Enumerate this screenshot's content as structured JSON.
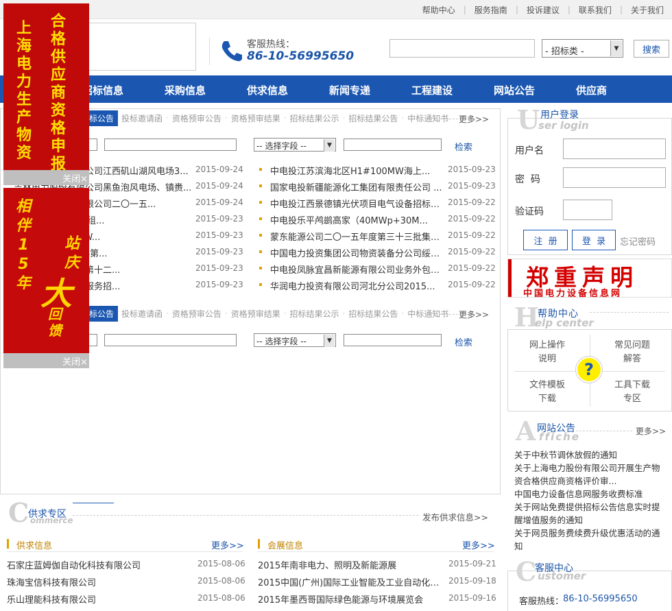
{
  "top_links": [
    "帮助中心",
    "服务指南",
    "投诉建议",
    "联系我们",
    "关于我们"
  ],
  "hotline": {
    "label": "客服热线：",
    "number": "86-10-56995650"
  },
  "search": {
    "select": "- 招标类 -",
    "button": "搜索"
  },
  "nav": [
    "招标信息",
    "采购信息",
    "供求信息",
    "新闻专递",
    "工程建设",
    "网站公告",
    "供应商"
  ],
  "tabs": {
    "active": "招标公告",
    "items": [
      "投标邀请函",
      "资格预审公告",
      "资格预审结果",
      "招标结果公示",
      "招标结果公告",
      "中标通知书"
    ],
    "more": "更多>>"
  },
  "filter": {
    "select": "-- 选择字段 --",
    "button": "检索"
  },
  "list_left": [
    {
      "title": "吉林电力股份有限公司江西矶山湖风电场3...",
      "date": "2015-09-24"
    },
    {
      "title": "吉林电力股份有限公司黑鱼泡风电场、镇赉...",
      "date": "2015-09-24"
    },
    {
      "title": "中电投集团股份有限公司二〇一五...",
      "date": "2015-09-24"
    },
    {
      "title": "电厂2×350MW机组...",
      "date": "2015-09-23"
    },
    {
      "title": "厂二期2×1000MW...",
      "date": "2015-09-23"
    },
    {
      "title": "展有限公司2015年第...",
      "date": "2015-09-23"
    },
    {
      "title": "公司二〇一五年度第十二...",
      "date": "2015-09-23"
    },
    {
      "title": "有限公司物业管理服务招...",
      "date": "2015-09-23"
    }
  ],
  "list_right": [
    {
      "title": "中电投江苏滨海北区H1#100MW海上...",
      "date": "2015-09-23"
    },
    {
      "title": "国家电投新疆能源化工集团有限责任公司 ...",
      "date": "2015-09-23"
    },
    {
      "title": "中电投江西景德镇光伏项目电气设备招标公...",
      "date": "2015-09-22"
    },
    {
      "title": "中电投乐平鸬鹚高家（40MWp+30M...",
      "date": "2015-09-22"
    },
    {
      "title": "蒙东能源公司二〇一五年度第三十三批集中...",
      "date": "2015-09-22"
    },
    {
      "title": "中国电力投资集团公司物资装备分公司绥阳...",
      "date": "2015-09-22"
    },
    {
      "title": "中电投凤脉宜昌新能源有限公司业务外包招...",
      "date": "2015-09-22"
    },
    {
      "title": "华润电力投资有限公司河北分公司2015...",
      "date": "2015-09-22"
    }
  ],
  "ads": {
    "ad1_left": "上海电力生产物资",
    "ad1_right": "合格供应商资格申报",
    "ad2_top": "相伴15年",
    "ad2_mid": "站庆",
    "ad2_big": "大",
    "ad2_bottom": "回馈",
    "close": "关闭×"
  },
  "login": {
    "title": "用户登录",
    "subtitle": "ser login",
    "big_letter": "U",
    "username_label": "用户名",
    "password_label": "密  码",
    "captcha_label": "验证码",
    "register": "注  册",
    "login": "登  录",
    "forgot": "忘记密码"
  },
  "banner": {
    "main": "郑重声明",
    "sub": "中国电力设备信息网"
  },
  "help": {
    "title": "帮助中心",
    "subtitle": "elp center",
    "big_letter": "H",
    "cells": [
      [
        "网上操作",
        "说明"
      ],
      [
        "常见问题",
        "解答"
      ],
      [
        "文件模板",
        "下载"
      ],
      [
        "工具下载",
        "专区"
      ]
    ],
    "icon": "?"
  },
  "affiche": {
    "title": "网站公告",
    "subtitle": "ffiche",
    "big_letter": "A",
    "more": "更多>>",
    "items": [
      "关于中秋节调休放假的通知",
      "关于上海电力股份有限公司开展生产物资合格供应商资格评价审...",
      "中国电力设备信息网服务收费标准",
      "关于网站免费提供招标公告信息实时提醒增值服务的通知",
      "关于网员服务费续费升级优惠活动的通知"
    ]
  },
  "customer": {
    "title": "客服中心",
    "subtitle": "ustomer",
    "big_letter": "C",
    "hotline_label": "客服热线：",
    "hotline": "86-10-56995650"
  },
  "commerce": {
    "title": "供求专区",
    "subtitle": "ommerce",
    "big_letter": "C",
    "publish": "发布供求信息>>",
    "supply_title": "供求信息",
    "supply_more": "更多>>",
    "supply": [
      {
        "title": "石家庄蓝姆伽自动化科技有限公司",
        "date": "2015-08-06"
      },
      {
        "title": "珠海宝信科技有限公司",
        "date": "2015-08-06"
      },
      {
        "title": "乐山理能科技有限公司",
        "date": "2015-08-06"
      }
    ],
    "expo_title": "会展信息",
    "expo_more": "更多>>",
    "expo": [
      {
        "title": "2015年南非电力、照明及新能源展",
        "date": "2015-09-21"
      },
      {
        "title": "2015中国(广州)国际工业智能及工业自动化展览",
        "date": "2015-09-18"
      },
      {
        "title": "2015年墨西哥国际绿色能源与环境展览会",
        "date": "2015-09-16"
      }
    ]
  }
}
